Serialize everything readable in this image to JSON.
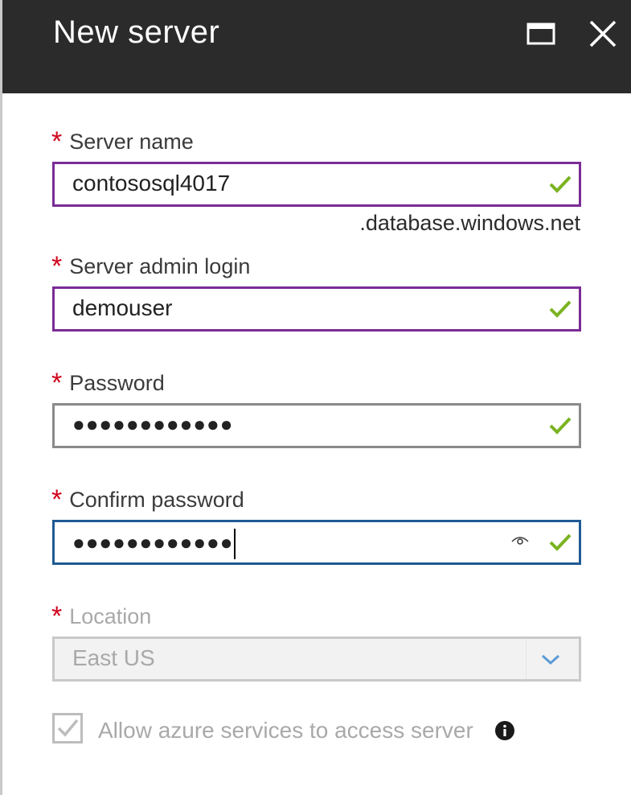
{
  "header": {
    "title": "New server"
  },
  "form": {
    "server_name": {
      "label": "Server name",
      "value": "contososql4017",
      "suffix": ".database.windows.net"
    },
    "admin_login": {
      "label": "Server admin login",
      "value": "demouser"
    },
    "password": {
      "label": "Password",
      "masked_value": "●●●●●●●●●●●●"
    },
    "confirm_password": {
      "label": "Confirm password",
      "masked_value": "●●●●●●●●●●●●"
    },
    "location": {
      "label": "Location",
      "selected": "East US"
    },
    "allow_azure": {
      "label": "Allow azure services to access server",
      "checked": true
    }
  },
  "colors": {
    "titlebar": "#2b2b2b",
    "required_star": "#d0021b",
    "valid_check": "#7bb321",
    "purple_border": "#7a2b96",
    "focus_border": "#1f5a93",
    "chevron": "#5b9bd5"
  },
  "icons": {
    "maximize": "maximize-icon",
    "close": "close-icon",
    "valid": "checkmark-icon",
    "reveal": "eye-icon",
    "dropdown": "chevron-down-icon",
    "info": "info-icon"
  }
}
